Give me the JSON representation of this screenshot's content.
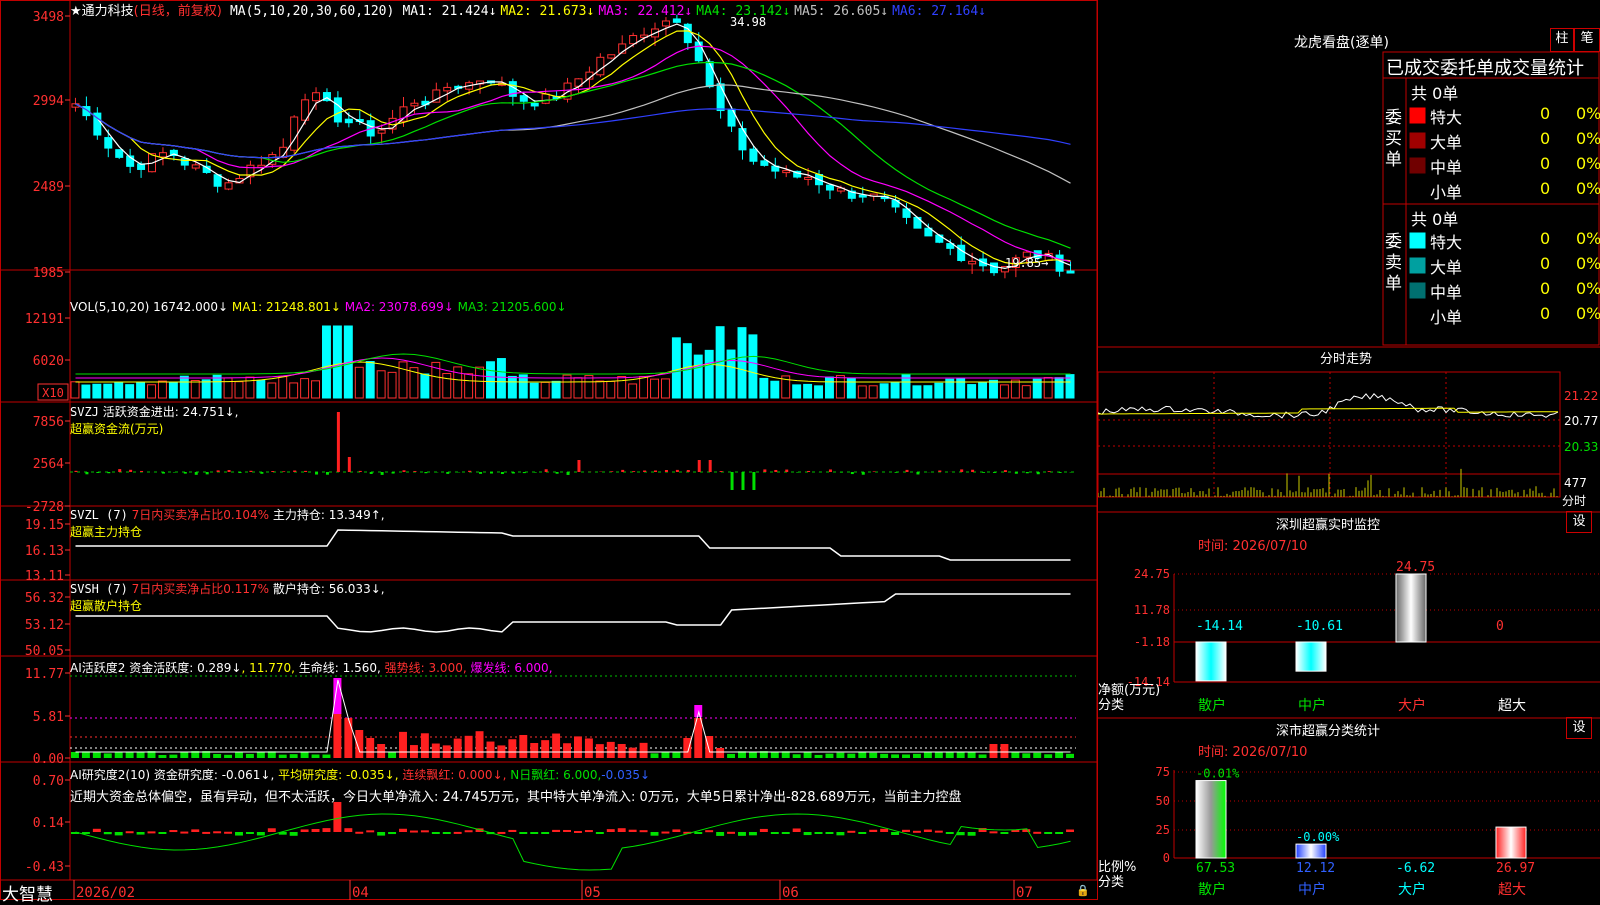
{
  "stock": {
    "name": "通力科技",
    "period": "(日线，前复权)"
  },
  "ma_line": {
    "label": "MA(5,10,20,30,60,120)",
    "items": [
      {
        "text": "MA1: 21.424↓",
        "color": "#ffffff"
      },
      {
        "text": "MA2: 21.673↓",
        "color": "#ffff00"
      },
      {
        "text": "MA3: 22.412↓",
        "color": "#ff00ff"
      },
      {
        "text": "MA4: 23.142↓",
        "color": "#00e000"
      },
      {
        "text": "MA5: 26.605↓",
        "color": "#c0c0c0"
      },
      {
        "text": "MA6: 27.164↓",
        "color": "#3040ff"
      }
    ]
  },
  "price_axis": [
    "3498",
    "2994",
    "2489",
    "1985"
  ],
  "price_marks": {
    "high": "34.98",
    "low": "19.85"
  },
  "vol": {
    "label": "VOL(5,10,20)",
    "value": "16742.000↓",
    "ma1": "MA1: 21248.801↓",
    "ma2": "MA2: 23078.699↓",
    "ma3": "MA3: 21205.600↓",
    "axis": [
      "12191",
      "6020"
    ],
    "unit": "X10"
  },
  "svzj": {
    "label": "SVZJ",
    "text": "活跃资金进出: 24.751↓,",
    "sub": "超赢资金流(万元)",
    "axis": [
      "7856",
      "2564",
      "-2728"
    ]
  },
  "svzl": {
    "label": "SVZL (7)",
    "t1": "7日内买卖净占比0.104%",
    "t2": "主力持仓: 13.349↑,",
    "sub": "超赢主力持仓",
    "axis": [
      "19.15",
      "16.13",
      "13.11"
    ]
  },
  "svsh": {
    "label": "SVSH (7)",
    "t1": "7日内买卖净占比0.117%",
    "t2": "散户持仓: 56.033↓,",
    "sub": "超赢散户持仓",
    "axis": [
      "56.32",
      "53.12",
      "50.05"
    ]
  },
  "ai1": {
    "label": "AI活跃度2",
    "t1": "资金活跃度: 0.289↓",
    "t2": ", 11.770,",
    "t3": "生命线: 1.560,",
    "t4": "强势线: 3.000,",
    "t5": "爆发线: 6.000,",
    "axis": [
      "11.77",
      "5.81",
      "0.00"
    ]
  },
  "ai2": {
    "label": "AI研究度2(10)",
    "t1": "资金研究度: -0.061↓,",
    "t2": "平均研究度: -0.035↓,",
    "t3": "连续飘红: 0.000↓,",
    "t4": "N日飘红: 6.000,",
    "t5": "-0.035↓",
    "axis": [
      "0.70",
      "0.14",
      "-0.43"
    ],
    "comment": "近期大资金总体偏空，虽有异动，但不太活跃，今日大单净流入: 24.745万元，其中特大单净流入: 0万元，大单5日累计净出-828.689万元，当前主力控盘"
  },
  "bottom": {
    "brand": "大智慧",
    "dates": [
      "2026/02",
      "04",
      "05",
      "06",
      "07"
    ]
  },
  "lhb": {
    "title": "龙虎看盘(逐单)",
    "btn1": "柱",
    "btn2": "笔",
    "sub": "已成交委托单成交量统计",
    "buy": {
      "side": "委买单",
      "total": "共 0单",
      "rows": [
        {
          "name": "特大",
          "qty": "0",
          "pct": "0%",
          "color": "#ff0000"
        },
        {
          "name": "大单",
          "qty": "0",
          "pct": "0%",
          "color": "#a00000"
        },
        {
          "name": "中单",
          "qty": "0",
          "pct": "0%",
          "color": "#700000"
        },
        {
          "name": "小单",
          "qty": "0",
          "pct": "0%",
          "color": "#000000"
        }
      ]
    },
    "sell": {
      "side": "委卖单",
      "total": "共 0单",
      "rows": [
        {
          "name": "特大",
          "qty": "0",
          "pct": "0%",
          "color": "#00ffff"
        },
        {
          "name": "大单",
          "qty": "0",
          "pct": "0%",
          "color": "#00a0a0"
        },
        {
          "name": "中单",
          "qty": "0",
          "pct": "0%",
          "color": "#007070"
        },
        {
          "name": "小单",
          "qty": "0",
          "pct": "0%",
          "color": "#000000"
        }
      ]
    }
  },
  "fenshi": {
    "title": "分时走势",
    "axis": [
      "21.22",
      "20.77",
      "20.33"
    ],
    "vol": "477",
    "vlabel": "分时"
  },
  "sz_monitor": {
    "title": "深圳超赢实时监控",
    "btn": "设",
    "time": "时间: 2026/07/10",
    "axis": [
      "24.75",
      "11.78",
      "-1.18",
      "-14.14"
    ],
    "values": [
      {
        "cat": "散户",
        "val": "-14.14",
        "v": -14.14
      },
      {
        "cat": "中户",
        "val": "-10.61",
        "v": -10.61
      },
      {
        "cat": "大户",
        "val": "24.75",
        "v": 24.75
      },
      {
        "cat": "超大",
        "val": "0",
        "v": 0
      }
    ],
    "ylabel": "净额(万元)",
    "xlabel": "分类"
  },
  "sz_class": {
    "title": "深市超赢分类统计",
    "btn": "设",
    "time": "时间: 2026/07/10",
    "axis": [
      "75",
      "50",
      "25",
      "0"
    ],
    "values": [
      {
        "cat": "散户",
        "top": "-0.01%",
        "bottom": "67.53",
        "v": 67.53
      },
      {
        "cat": "中户",
        "top": "-0.00%",
        "bottom": "12.12",
        "v": 12.12
      },
      {
        "cat": "大户",
        "top": "",
        "bottom": "-6.62",
        "v": 0
      },
      {
        "cat": "超大",
        "top": "",
        "bottom": "26.97",
        "v": 26.97
      }
    ],
    "ylabel": "比例%",
    "xlabel": "分类"
  }
}
